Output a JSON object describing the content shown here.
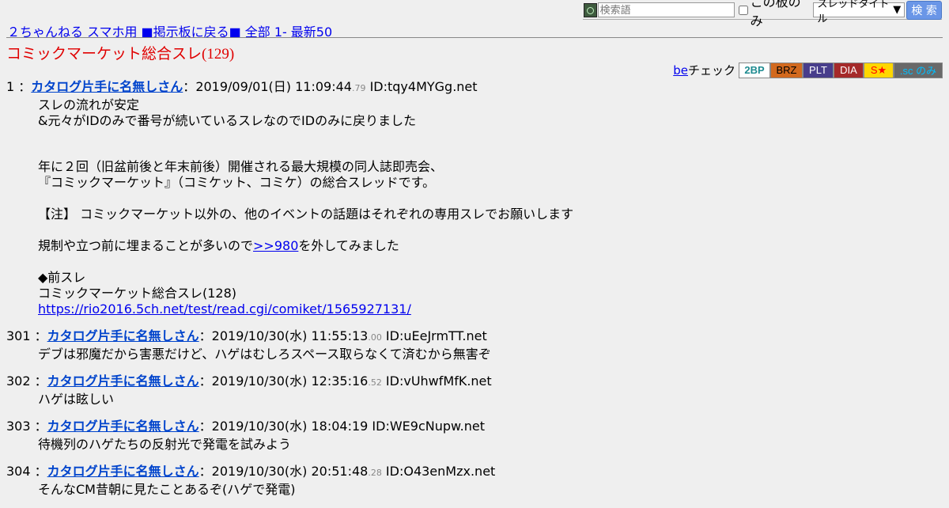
{
  "search": {
    "placeholder": "検索語",
    "board_only_label": "この板のみ",
    "select_value": "スレッドタイトル",
    "button_label": "検 索"
  },
  "nav": {
    "home": "２ちゃんねる",
    "mobile": "スマホ用",
    "back": "■掲示板に戻る■",
    "all": "全部",
    "first": "1-",
    "latest": "最新50"
  },
  "thread_title": "コミックマーケット総合スレ(129)",
  "be_check": {
    "link": "be",
    "label": "チェック",
    "buttons": [
      "2BP",
      "BRZ",
      "PLT",
      "DIA",
      "S★",
      ".sc のみ"
    ]
  },
  "posts": [
    {
      "num": "1",
      "name": "カタログ片手に名無しさん",
      "date": "2019/09/01(日) 11:09:44",
      "ms": ".79",
      "id": "ID:tqy4MYGg.net",
      "lines": [
        "スレの流れが安定",
        "&元々がIDのみで番号が続いているスレなのでIDのみに戻りました",
        "",
        "",
        "年に２回（旧盆前後と年末前後）開催される最大規模の同人誌即売会、",
        "『コミックマーケット』（コミケット、コミケ）の総合スレッドです。",
        "",
        "【注】 コミックマーケット以外の、他のイベントの話題はそれぞれの専用スレでお願いします",
        "",
        "規制や立つ前に埋まることが多いので",
        "",
        "◆前スレ",
        "コミックマーケット総合スレ(128)",
        ""
      ],
      "anchor_pre": "規制や立つ前に埋まることが多いので",
      "anchor": ">>980",
      "anchor_post": "を外してみました",
      "url": "https://rio2016.5ch.net/test/read.cgi/comiket/1565927131/"
    },
    {
      "num": "301",
      "name": "カタログ片手に名無しさん",
      "date": "2019/10/30(水) 11:55:13",
      "ms": ".00",
      "id": "ID:uEeJrmTT.net",
      "text": "デブは邪魔だから害悪だけど、ハゲはむしろスペース取らなくて済むから無害ぞ"
    },
    {
      "num": "302",
      "name": "カタログ片手に名無しさん",
      "date": "2019/10/30(水) 12:35:16",
      "ms": ".52",
      "id": "ID:vUhwfMfK.net",
      "text": "ハゲは眩しい"
    },
    {
      "num": "303",
      "name": "カタログ片手に名無しさん",
      "date": "2019/10/30(水) 18:04:19",
      "ms": "",
      "id": "ID:WE9cNupw.net",
      "text": "待機列のハゲたちの反射光で発電を試みよう"
    },
    {
      "num": "304",
      "name": "カタログ片手に名無しさん",
      "date": "2019/10/30(水) 20:51:48",
      "ms": ".28",
      "id": "ID:O43enMzx.net",
      "text": "そんなCM昔朝に見たことあるぞ(ハゲで発電)"
    }
  ]
}
